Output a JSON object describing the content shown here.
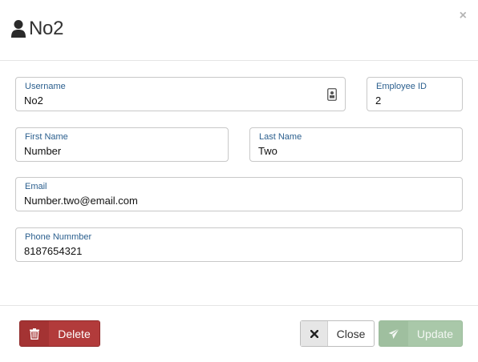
{
  "header": {
    "title": "No2",
    "title_icon": "user-icon",
    "close_symbol": "×"
  },
  "form": {
    "username": {
      "label": "Username",
      "value": "No2",
      "icon": "contact-card-icon"
    },
    "employee_id": {
      "label": "Employee ID",
      "value": "2"
    },
    "first_name": {
      "label": "First Name",
      "value": "Number"
    },
    "last_name": {
      "label": "Last Name",
      "value": "Two"
    },
    "email": {
      "label": "Email",
      "value": "Number.two@email.com"
    },
    "phone": {
      "label": "Phone Nummber",
      "value": "8187654321"
    }
  },
  "footer": {
    "delete_label": "Delete",
    "delete_icon": "trash-icon",
    "close_label": "Close",
    "close_icon": "close-icon",
    "update_label": "Update",
    "update_icon": "send-icon"
  },
  "colors": {
    "label": "#2b5f8e",
    "delete": "#b23b3b",
    "update_disabled": "#a9c8a9"
  }
}
